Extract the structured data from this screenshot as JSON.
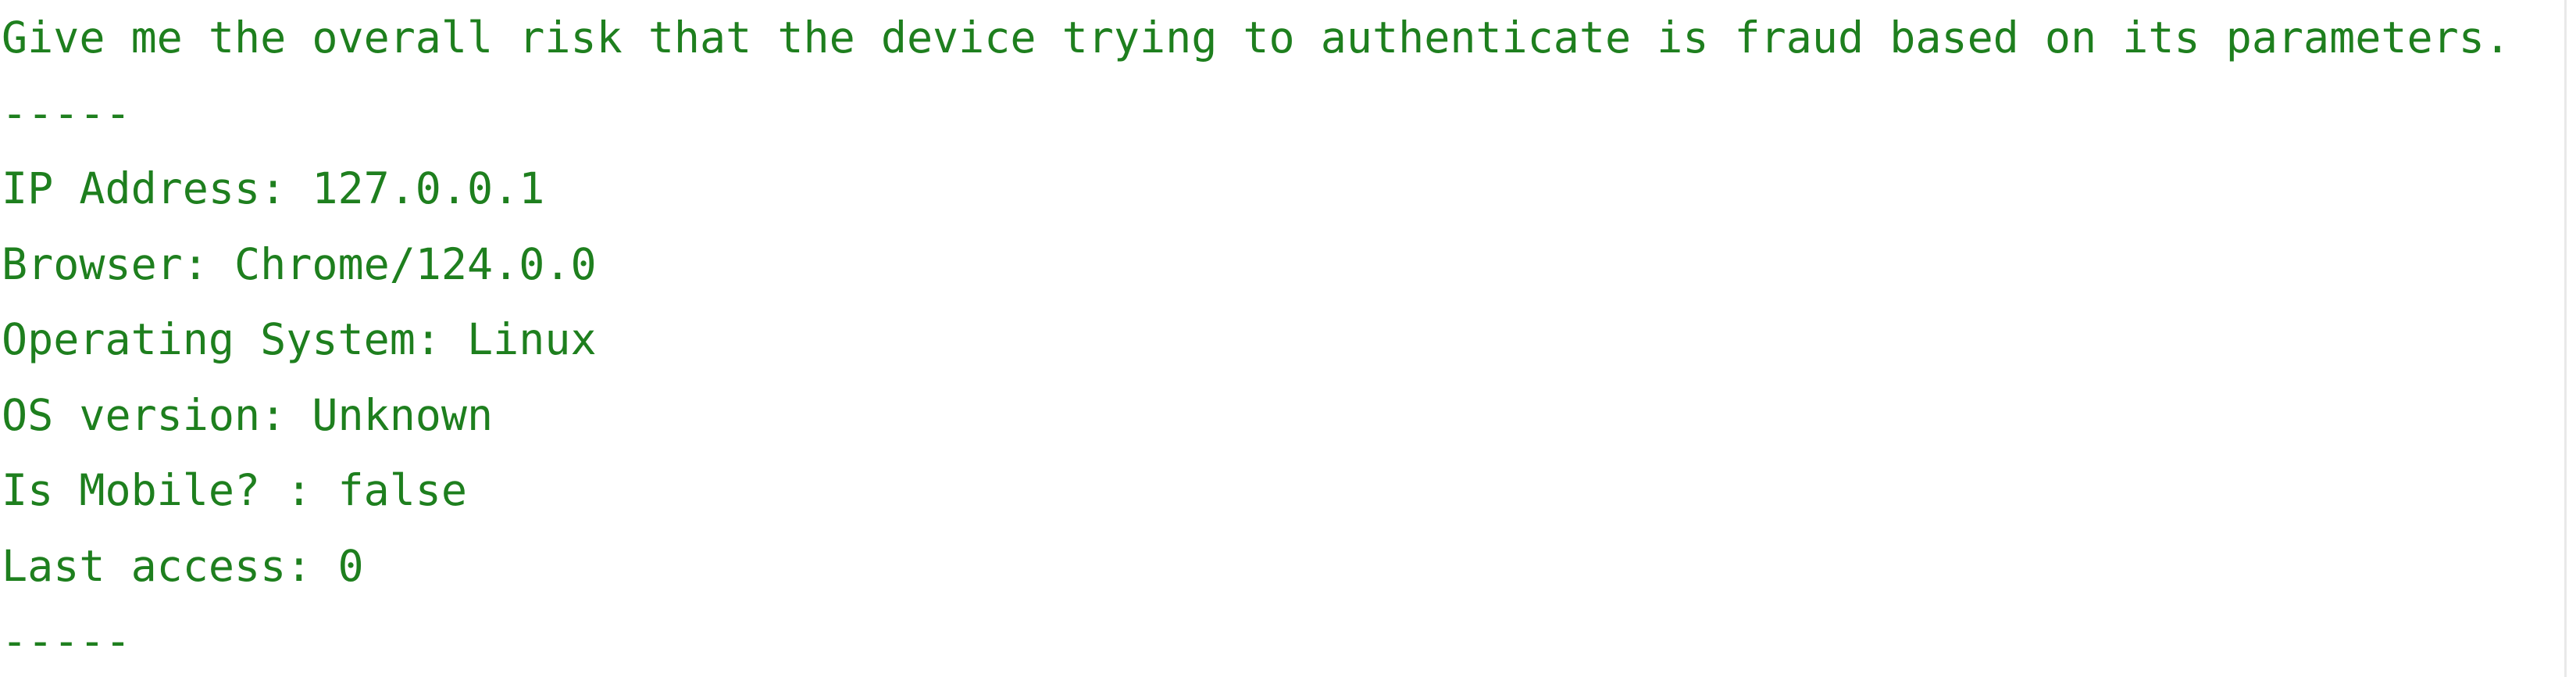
{
  "colors": {
    "output_text": "#1e7f1e",
    "background": "#ffffff"
  },
  "console": {
    "lines": [
      "Give me the overall risk that the device trying to authenticate is fraud based on its parameters.",
      "-----",
      "IP Address: 127.0.0.1",
      "Browser: Chrome/124.0.0",
      "Operating System: Linux",
      "OS version: Unknown",
      "Is Mobile? : false",
      "Last access: 0",
      "-----"
    ]
  }
}
